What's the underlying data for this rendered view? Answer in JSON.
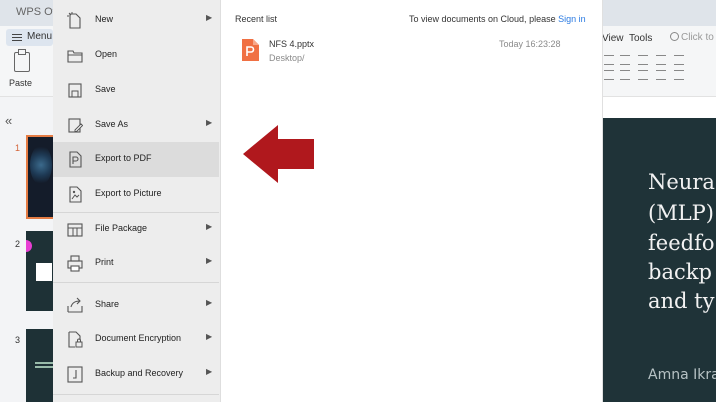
{
  "app": {
    "title": "WPS Office",
    "menu_label": "Menu",
    "paste_label": "Paste",
    "tabs": [
      "View",
      "Tools"
    ],
    "search_placeholder": "Click to"
  },
  "slides_panel": {
    "collapse_icon": "double-chevron-left-icon",
    "slides": [
      {
        "number": "1",
        "active": true
      },
      {
        "number": "2",
        "active": false
      },
      {
        "number": "3",
        "active": false
      }
    ]
  },
  "slide_preview": {
    "lines": [
      "Neura",
      "(MLP)",
      "feedfo",
      "backp",
      "and ty"
    ],
    "author": "Amna Ikra"
  },
  "file_menu": {
    "items": [
      {
        "label": "New",
        "icon": "new-document-icon",
        "submenu": true
      },
      {
        "label": "Open",
        "icon": "folder-open-icon",
        "submenu": false
      },
      {
        "label": "Save",
        "icon": "save-icon",
        "submenu": false
      },
      {
        "label": "Save As",
        "icon": "save-as-icon",
        "submenu": true
      },
      {
        "label": "Export to PDF",
        "icon": "export-pdf-icon",
        "submenu": false,
        "highlighted": true
      },
      {
        "label": "Export to Picture",
        "icon": "export-picture-icon",
        "submenu": false
      },
      {
        "label": "File Package",
        "icon": "file-package-icon",
        "submenu": true
      },
      {
        "label": "Print",
        "icon": "print-icon",
        "submenu": true
      },
      {
        "label": "Share",
        "icon": "share-icon",
        "submenu": true
      },
      {
        "label": "Document Encryption",
        "icon": "document-encryption-icon",
        "submenu": true
      },
      {
        "label": "Backup and Recovery",
        "icon": "backup-recovery-icon",
        "submenu": true
      }
    ],
    "submenu_arrow": "▶"
  },
  "recent": {
    "header": "Recent list",
    "cloud_prompt": "To view documents on Cloud, please",
    "signin_label": "Sign in",
    "files": [
      {
        "name": "NFS 4.pptx",
        "path": "Desktop/",
        "time": "Today 16:23:28",
        "icon": "pptx-file-icon"
      }
    ]
  },
  "annotation": {
    "icon": "red-arrow-left-icon",
    "color": "#b0181d"
  },
  "colors": {
    "accent": "#2a7ae2",
    "active_slide_border": "#e57c44",
    "slide_bg": "#1f3338"
  }
}
